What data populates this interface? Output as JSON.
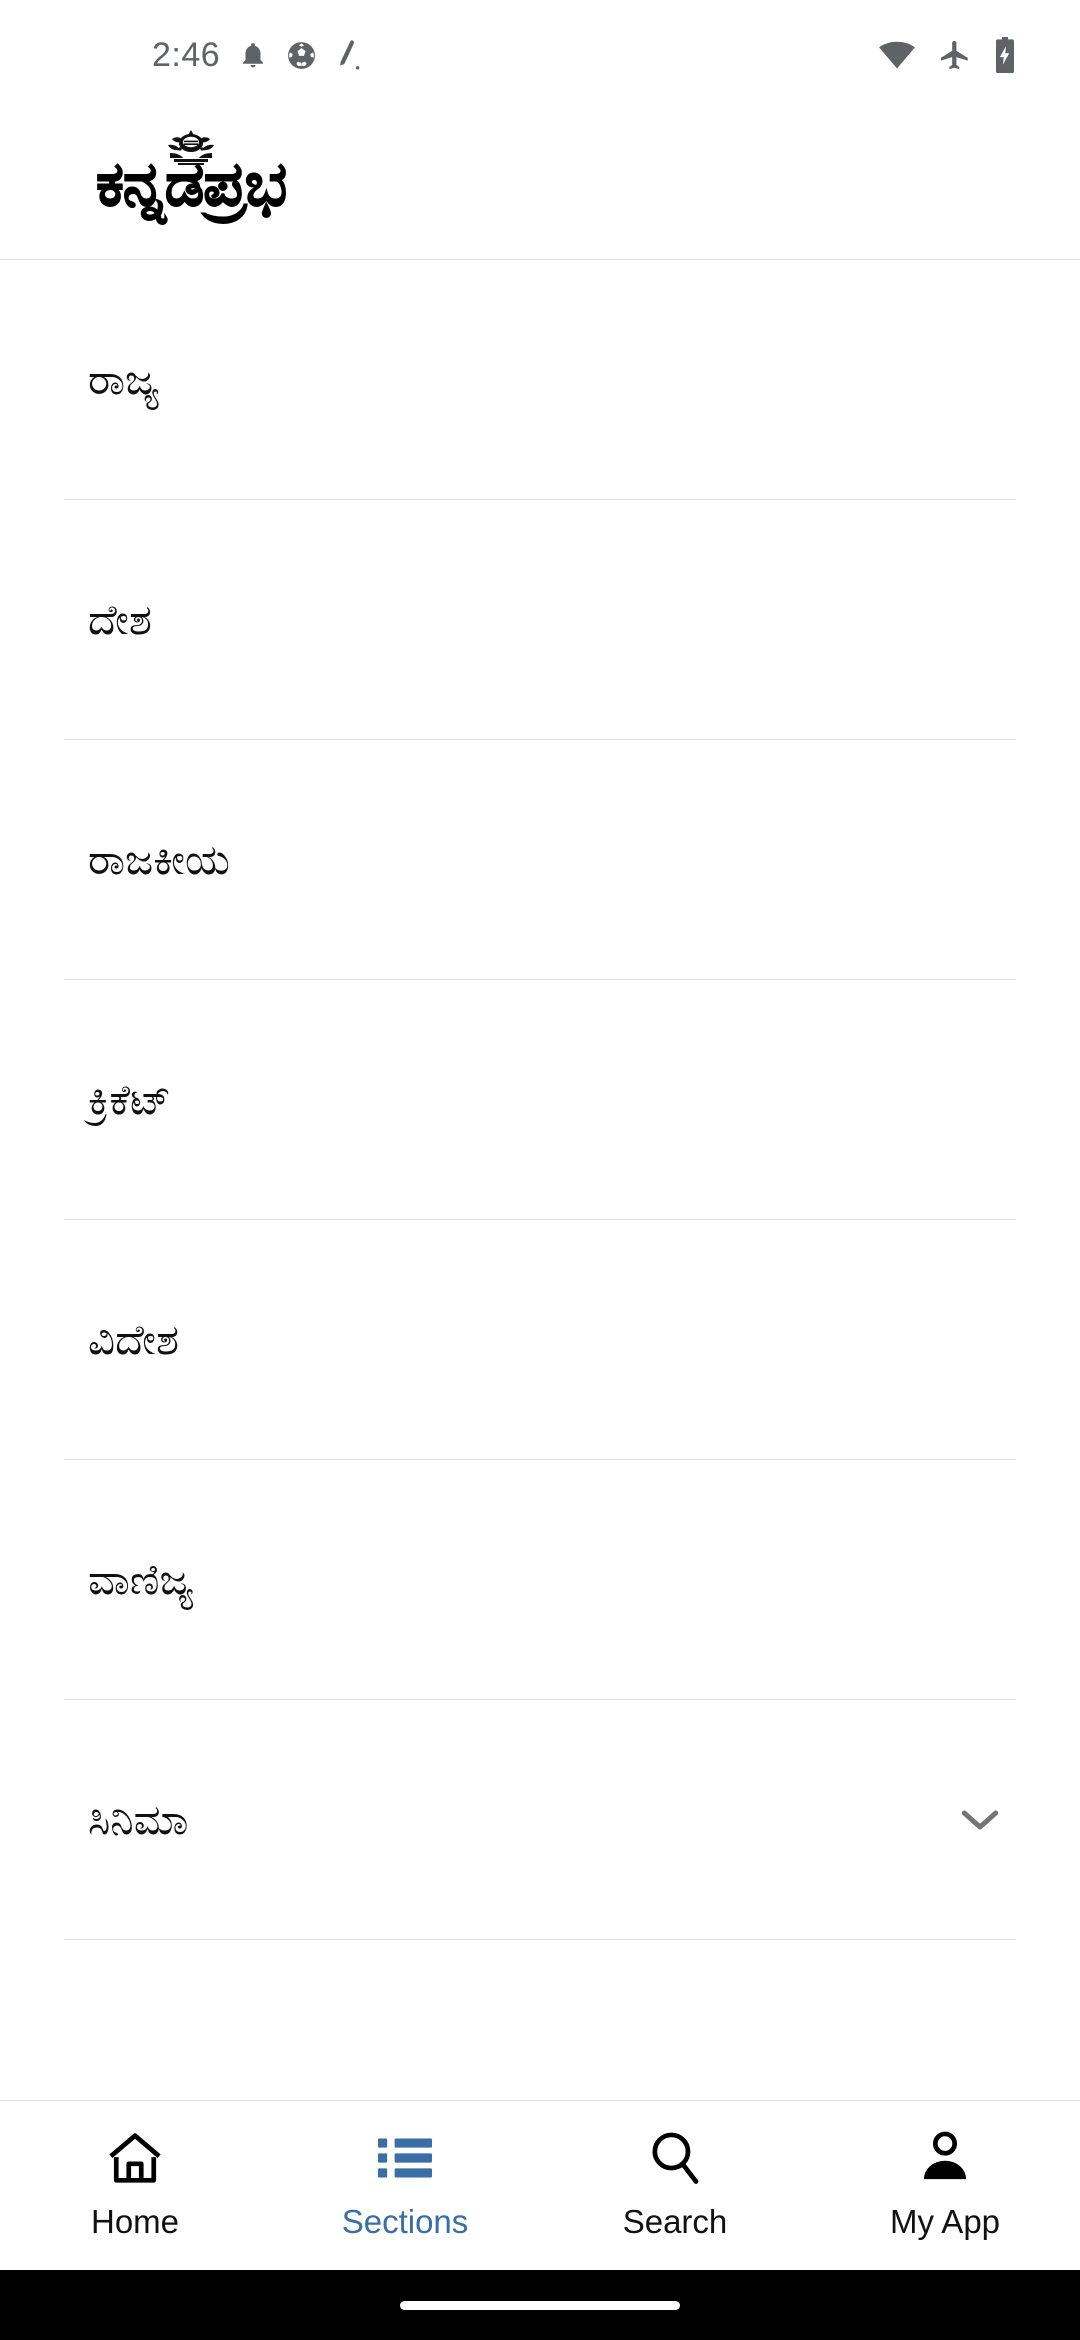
{
  "status_bar": {
    "time": "2:46",
    "left_icons": [
      "notification-bell-icon",
      "football-icon",
      "cricket-bat-icon"
    ],
    "right_icons": [
      "wifi-icon",
      "airplane-mode-icon",
      "battery-charging-icon"
    ]
  },
  "app_header": {
    "logo_text": "ಕನ್ನಡಪ್ರಭ",
    "crest_icon": "emblem-crest-icon"
  },
  "sections": {
    "items": [
      {
        "label": "ರಾಜ್ಯ",
        "has_chevron": false
      },
      {
        "label": "ದೇಶ",
        "has_chevron": false
      },
      {
        "label": "ರಾಜಕೀಯ",
        "has_chevron": false
      },
      {
        "label": "ಕ್ರಿಕೆಟ್",
        "has_chevron": false
      },
      {
        "label": "ವಿದೇಶ",
        "has_chevron": false
      },
      {
        "label": "ವಾಣಿಜ್ಯ",
        "has_chevron": false
      },
      {
        "label": "ಸಿನಿಮಾ",
        "has_chevron": true
      }
    ]
  },
  "bottom_nav": {
    "active_index": 1,
    "active_color": "#3a6ea5",
    "items": [
      {
        "label": "Home",
        "icon": "home-icon"
      },
      {
        "label": "Sections",
        "icon": "list-icon"
      },
      {
        "label": "Search",
        "icon": "search-icon"
      },
      {
        "label": "My App",
        "icon": "person-icon"
      }
    ]
  }
}
